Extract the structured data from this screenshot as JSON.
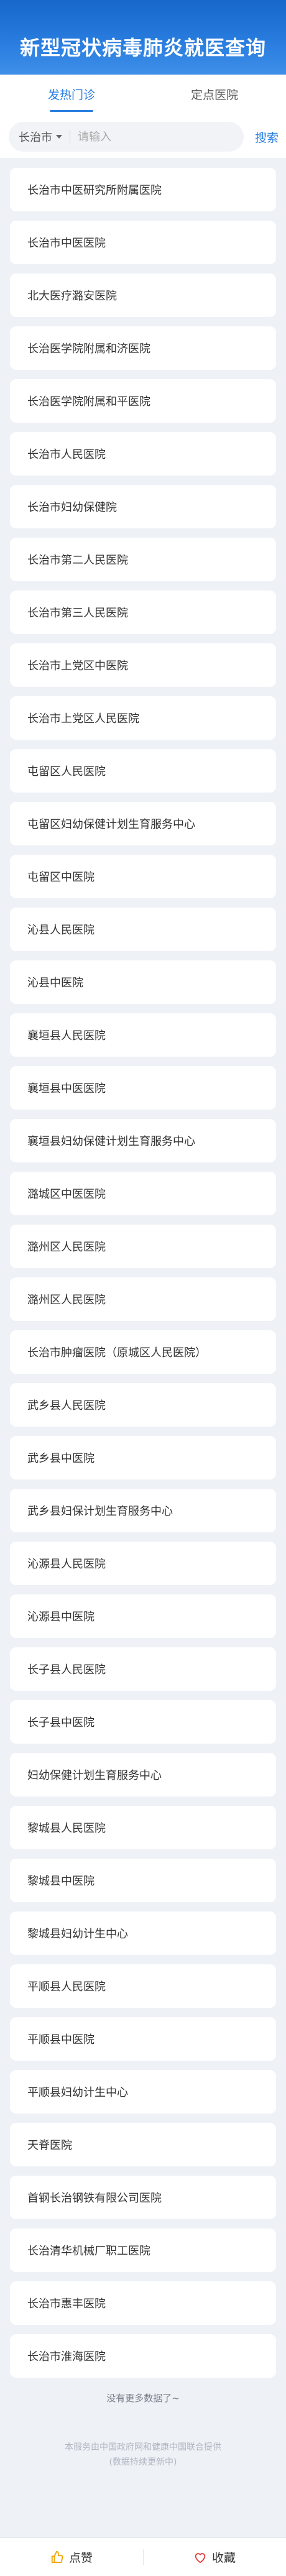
{
  "banner": {
    "title": "新型冠状病毒肺炎就医查询"
  },
  "tabs": [
    {
      "label": "发热门诊",
      "active": true
    },
    {
      "label": "定点医院",
      "active": false
    }
  ],
  "search": {
    "city": "长治市",
    "placeholder": "请输入",
    "button_label": "搜索"
  },
  "hospitals": [
    "长治市中医研究所附属医院",
    "长治市中医医院",
    "北大医疗潞安医院",
    "长治医学院附属和济医院",
    "长治医学院附属和平医院",
    "长治市人民医院",
    "长治市妇幼保健院",
    "长治市第二人民医院",
    "长治市第三人民医院",
    "长治市上党区中医院",
    "长治市上党区人民医院",
    "屯留区人民医院",
    "屯留区妇幼保健计划生育服务中心",
    "屯留区中医院",
    "沁县人民医院",
    "沁县中医院",
    "襄垣县人民医院",
    "襄垣县中医医院",
    "襄垣县妇幼保健计划生育服务中心",
    "潞城区中医医院",
    "潞州区人民医院",
    "潞州区人民医院",
    "长治市肿瘤医院（原城区人民医院）",
    "武乡县人民医院",
    "武乡县中医院",
    "武乡县妇保计划生育服务中心",
    "沁源县人民医院",
    "沁源县中医院",
    "长子县人民医院",
    "长子县中医院",
    "妇幼保健计划生育服务中心",
    "黎城县人民医院",
    "黎城县中医院",
    "黎城县妇幼计生中心",
    "平顺县人民医院",
    "平顺县中医院",
    "平顺县妇幼计生中心",
    "天脊医院",
    "首钢长治钢铁有限公司医院",
    "长治清华机械厂职工医院",
    "长治市惠丰医院",
    "长治市淮海医院"
  ],
  "list_end_text": "没有更多数据了~",
  "footnote": {
    "line1": "本服务由中国政府网和健康中国联合提供",
    "line2": "(数据持续更新中)"
  },
  "bottom_bar": {
    "like_label": "点赞",
    "like_icon": "thumbs-up-icon",
    "favorite_label": "收藏",
    "favorite_icon": "heart-icon",
    "favorite_color": "#e23c3c"
  }
}
